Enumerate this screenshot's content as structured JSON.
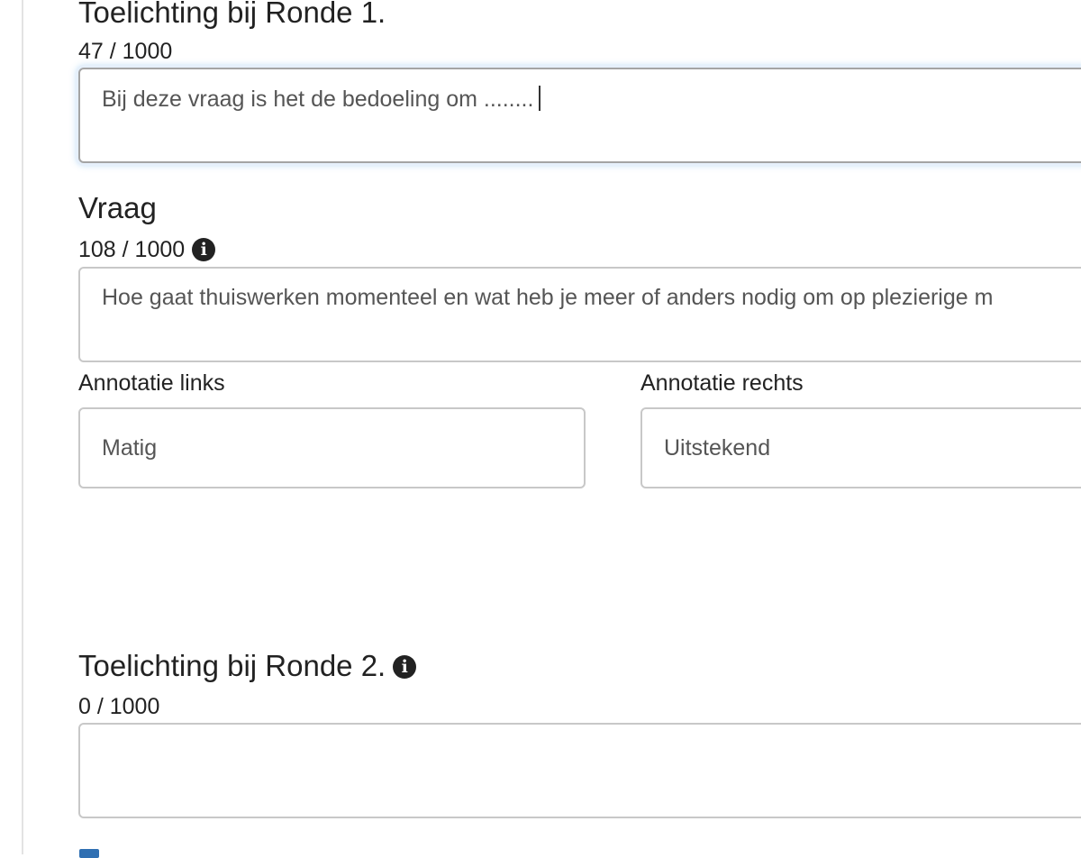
{
  "sections": {
    "ronde1": {
      "title": "Toelichting bij Ronde 1.",
      "counter": "47 / 1000",
      "value": "Bij deze vraag is het de bedoeling om ........"
    },
    "vraag": {
      "title": "Vraag",
      "counter": "108 / 1000",
      "info_icon": "info-circle-icon",
      "value": "Hoe gaat thuiswerken momenteel en wat heb je meer of anders nodig om op plezierige m"
    },
    "annotatie_links": {
      "label": "Annotatie links",
      "value": "Matig"
    },
    "annotatie_rechts": {
      "label": "Annotatie rechts",
      "value": "Uitstekend"
    },
    "ronde2": {
      "title": "Toelichting bij Ronde 2.",
      "info_icon": "info-circle-icon",
      "counter": "0 / 1000",
      "value": ""
    }
  },
  "colors": {
    "text": "#222222",
    "input_text": "#555555",
    "border": "#c8c8c8",
    "focus_glow": "#66afe9",
    "checkbox": "#2f6fb2"
  }
}
